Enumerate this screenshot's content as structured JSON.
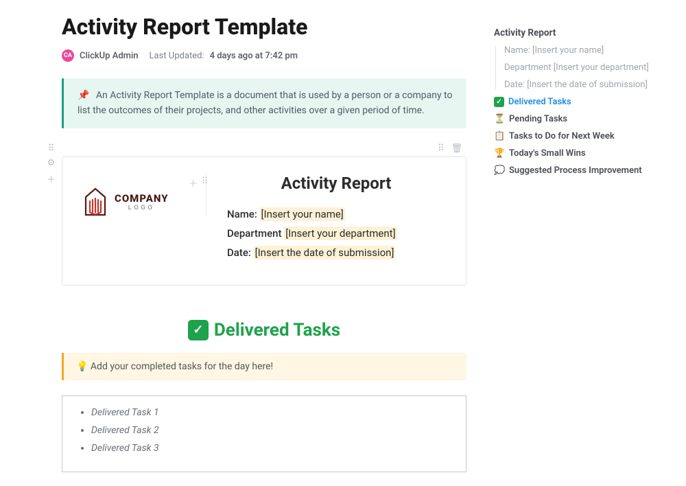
{
  "page_title": "Activity Report Template",
  "author": {
    "avatar_initials": "CA",
    "name": "ClickUp Admin",
    "updated_label": "Last Updated:",
    "updated_value": "4 days ago at 7:42 pm"
  },
  "intro_callout": {
    "icon": "📌",
    "text": "An Activity Report Template is a document that is used by a person or a company to list the outcomes of their projects, and other activities over a given period of time."
  },
  "card": {
    "logo_main": "COMPANY",
    "logo_sub": "LOGO",
    "heading": "Activity Report",
    "fields": [
      {
        "label": "Name:",
        "value": "[Insert your name]"
      },
      {
        "label": "Department",
        "value": "[Insert your department]"
      },
      {
        "label": "Date:",
        "value": "[Insert the date of submission]"
      }
    ]
  },
  "delivered_section": {
    "heading": "Delivered Tasks",
    "callout_icon": "💡",
    "callout_text": "Add your completed tasks for the day here!",
    "items": [
      "Delivered Task 1",
      "Delivered Task 2",
      "Delivered Task 3"
    ]
  },
  "sidebar": {
    "title": "Activity Report",
    "indent_items": [
      "Name: [Insert your name]",
      "Department [Insert your department]",
      "Date: [Insert the date of submission]"
    ],
    "items": [
      {
        "icon": "check",
        "label": "Delivered Tasks",
        "active": true
      },
      {
        "icon": "⏳",
        "label": "Pending Tasks",
        "active": false
      },
      {
        "icon": "📋",
        "label": "Tasks to Do for Next Week",
        "active": false
      },
      {
        "icon": "🏆",
        "label": "Today's Small Wins",
        "active": false
      },
      {
        "icon": "💭",
        "label": "Suggested Process Improvement",
        "active": false
      }
    ]
  }
}
